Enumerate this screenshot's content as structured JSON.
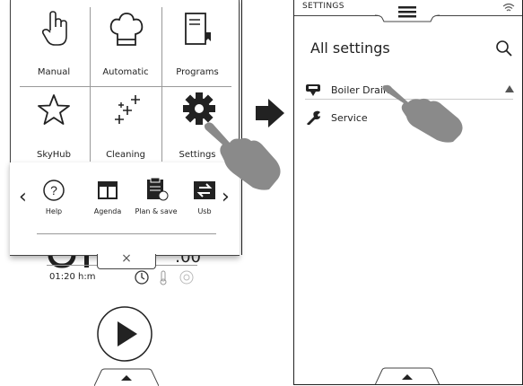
{
  "left": {
    "tiles": [
      {
        "label": "Manual",
        "icon": "hand-pointer-icon"
      },
      {
        "label": "Automatic",
        "icon": "chef-hat-icon"
      },
      {
        "label": "Programs",
        "icon": "recipe-book-icon"
      },
      {
        "label": "SkyHub",
        "icon": "star-icon"
      },
      {
        "label": "Cleaning",
        "icon": "sparkles-icon"
      },
      {
        "label": "Settings",
        "icon": "gear-icon"
      }
    ],
    "quick": [
      {
        "label": "Help",
        "icon": "question-icon"
      },
      {
        "label": "Agenda",
        "icon": "calendar-icon"
      },
      {
        "label": "Plan & save",
        "icon": "clipboard-icon"
      },
      {
        "label": "Usb",
        "icon": "usb-transfer-icon"
      }
    ],
    "close_symbol": "×",
    "timer_big": ":00",
    "timer_small": "01:20 h:m",
    "prev_symbol": "‹",
    "next_symbol": "›"
  },
  "right": {
    "header": "SETTINGS",
    "title": "All settings",
    "items": [
      {
        "label": "Boiler Drain",
        "icon": "boiler-drain-icon"
      },
      {
        "label": "Service",
        "icon": "wrench-icon"
      }
    ]
  },
  "colors": {
    "hand": "#8a8a8a",
    "arrow": "#222222",
    "divider": "#999999"
  }
}
